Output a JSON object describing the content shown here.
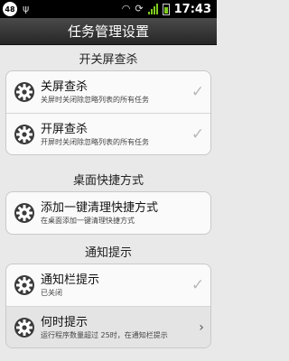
{
  "status_bar": {
    "badge": "48",
    "time": "17:43",
    "icons": [
      "usb-icon",
      "wifi-icon",
      "sync-icon",
      "signal-icon",
      "battery-icon"
    ]
  },
  "title": "任务管理设置",
  "sections": [
    {
      "header": "开关屏查杀",
      "items": [
        {
          "title": "关屏查杀",
          "desc": "关屏时关闭除忽略列表的所有任务",
          "control": "checkbox",
          "checked": true
        },
        {
          "title": "开屏查杀",
          "desc": "开屏时关闭除忽略列表的所有任务",
          "control": "checkbox",
          "checked": true
        }
      ]
    },
    {
      "header": "桌面快捷方式",
      "items": [
        {
          "title": "添加一键清理快捷方式",
          "desc": "在桌面添加一键清理快捷方式"
        }
      ]
    },
    {
      "header": "通知提示",
      "items": [
        {
          "title": "通知栏提示",
          "desc": "已关闭",
          "control": "checkbox",
          "checked": true
        },
        {
          "title": "何时提示",
          "desc": "运行程序数量超过 25时，在通知栏提示",
          "control": "chevron"
        }
      ]
    }
  ],
  "colors": {
    "background": "#e9e9e9",
    "card": "#fafafa",
    "titlebar": "#262626",
    "accent_green": "#7fcc1f"
  }
}
